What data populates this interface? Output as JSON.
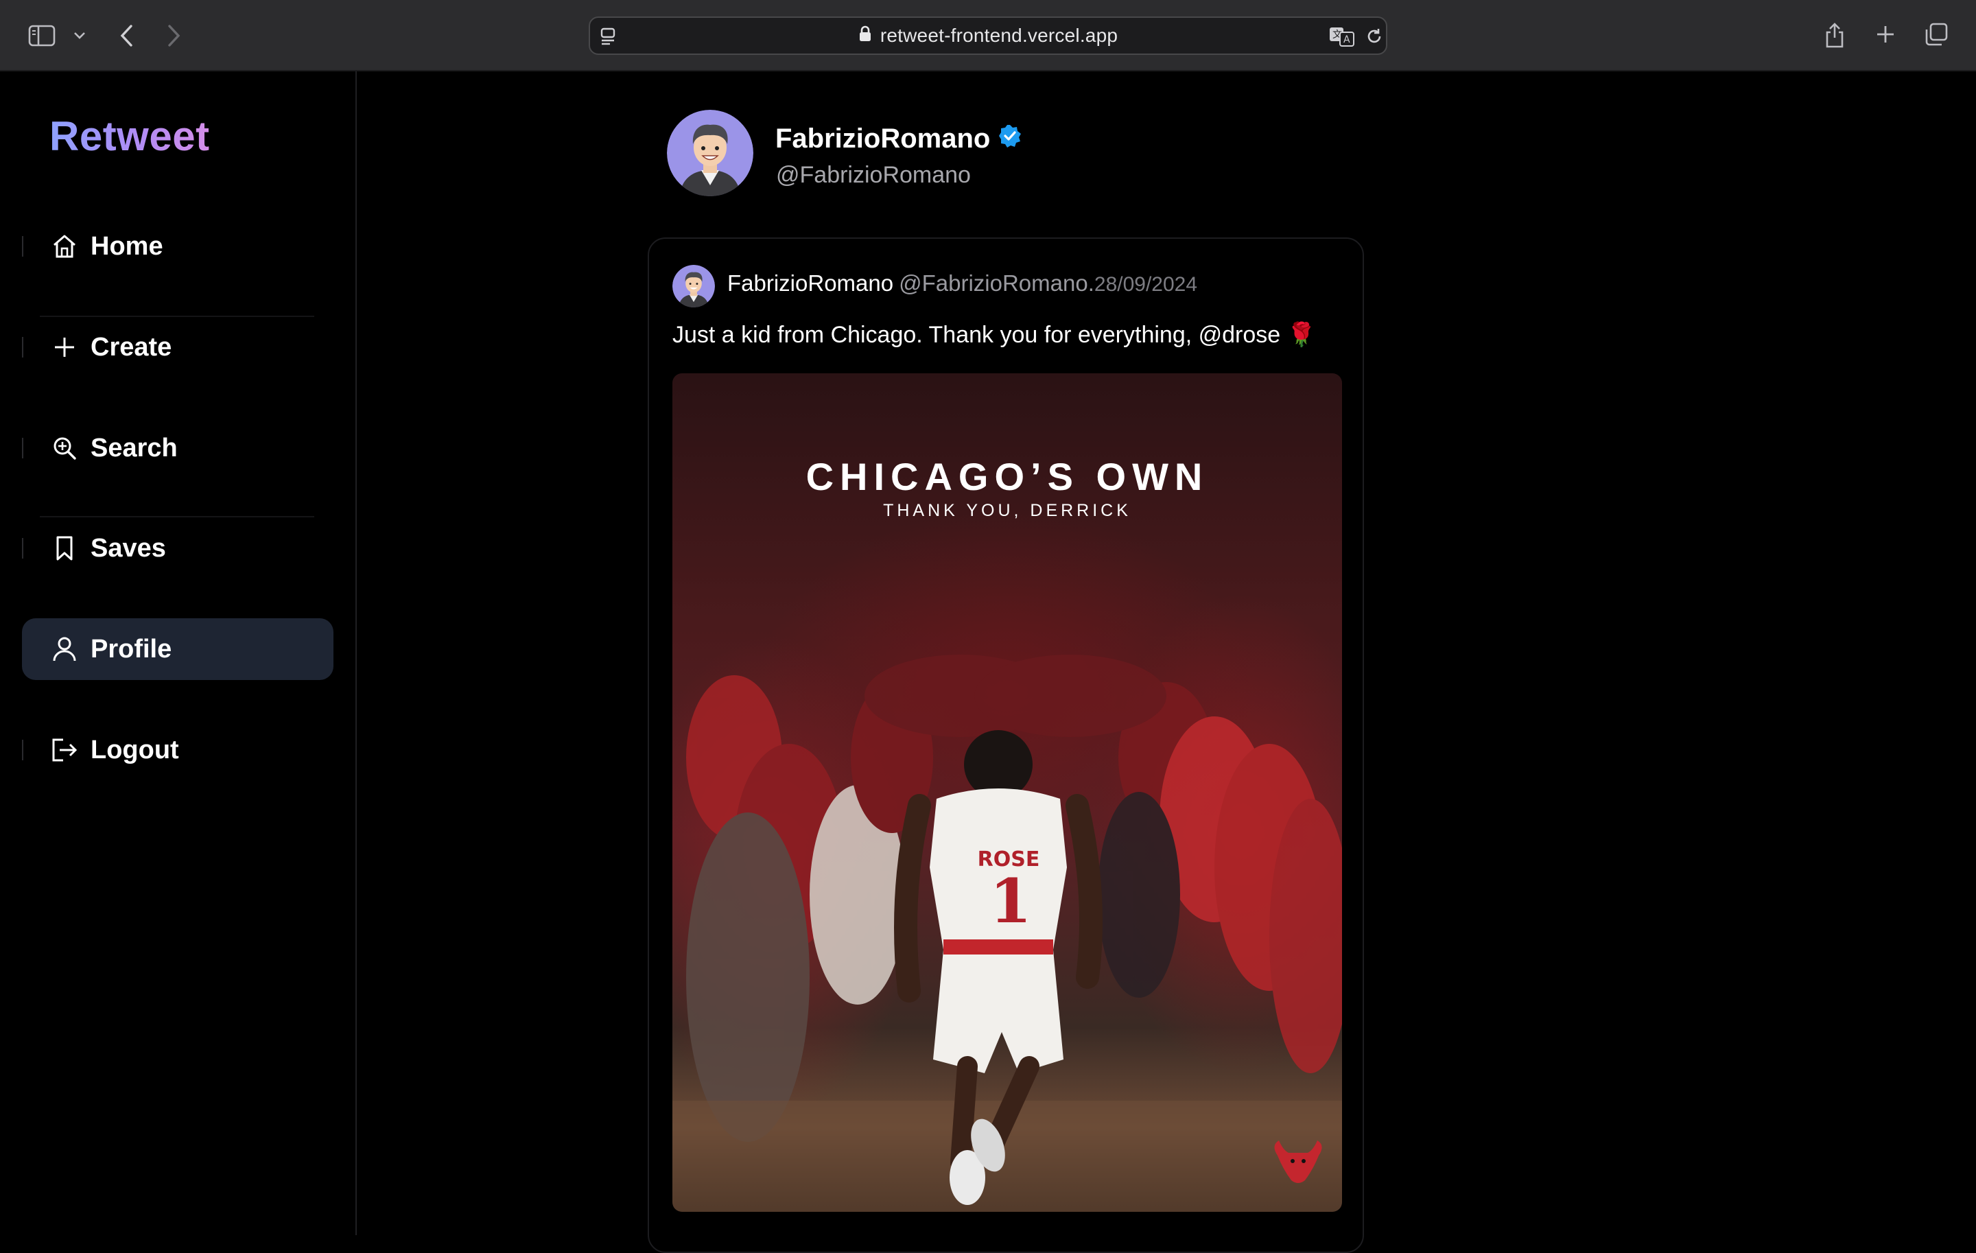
{
  "browser": {
    "url": "retweet-frontend.vercel.app"
  },
  "app": {
    "logo": "Retweet"
  },
  "sidebar": {
    "items": [
      {
        "label": "Home",
        "icon": "home-icon"
      },
      {
        "label": "Create",
        "icon": "plus-icon"
      },
      {
        "label": "Search",
        "icon": "search-icon"
      },
      {
        "label": "Saves",
        "icon": "bookmark-icon"
      },
      {
        "label": "Profile",
        "icon": "user-icon",
        "active": true
      },
      {
        "label": "Logout",
        "icon": "logout-icon"
      }
    ]
  },
  "profile": {
    "name": "FabrizioRomano",
    "handle": "@FabrizioRomano",
    "verified": true
  },
  "post": {
    "author": "FabrizioRomano",
    "handle": "@FabrizioRomano.",
    "date": "28/09/2024",
    "text": "Just a kid from Chicago. Thank you for everything, @drose 🌹",
    "media": {
      "title": "CHICAGO’S OWN",
      "subtitle": "THANK YOU, DERRICK",
      "jersey_name": "ROSE",
      "jersey_number": "1"
    }
  },
  "colors": {
    "background": "#000000",
    "active_nav": "#1e2533",
    "verified": "#1d9bf0",
    "logo_gradient_start": "#8ea2ff",
    "logo_gradient_end": "#d58ee8"
  }
}
